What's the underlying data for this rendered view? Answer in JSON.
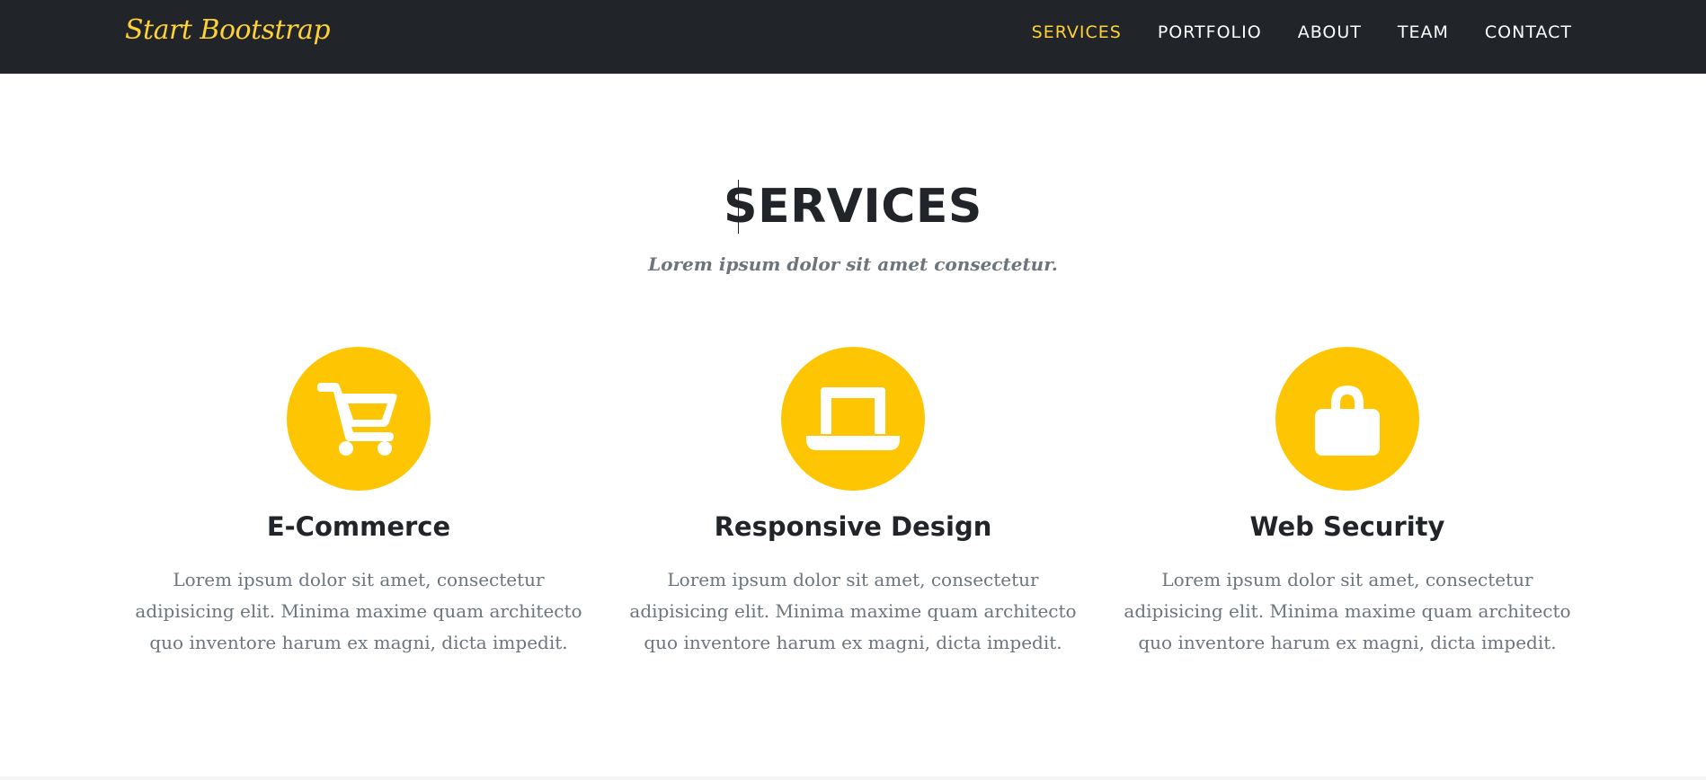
{
  "navbar": {
    "brand": "Start Bootstrap",
    "items": [
      {
        "label": "SERVICES",
        "active": true
      },
      {
        "label": "PORTFOLIO",
        "active": false
      },
      {
        "label": "ABOUT",
        "active": false
      },
      {
        "label": "TEAM",
        "active": false
      },
      {
        "label": "CONTACT",
        "active": false
      }
    ]
  },
  "section": {
    "heading": "SERVICES",
    "subheading": "Lorem ipsum dolor sit amet consectetur."
  },
  "services": [
    {
      "icon": "shopping-cart-icon",
      "title": "E-Commerce",
      "text": "Lorem ipsum dolor sit amet, consectetur adipisicing elit. Minima maxime quam architecto quo inventore harum ex magni, dicta impedit."
    },
    {
      "icon": "laptop-icon",
      "title": "Responsive Design",
      "text": "Lorem ipsum dolor sit amet, consectetur adipisicing elit. Minima maxime quam architecto quo inventore harum ex magni, dicta impedit."
    },
    {
      "icon": "lock-icon",
      "title": "Web Security",
      "text": "Lorem ipsum dolor sit amet, consectetur adipisicing elit. Minima maxime quam architecto quo inventore harum ex magni, dicta impedit."
    }
  ],
  "colors": {
    "navbar_bg": "#212529",
    "accent": "#fed136",
    "icon_circle": "#fec503",
    "heading": "#212529",
    "muted_text": "#6c757d"
  }
}
